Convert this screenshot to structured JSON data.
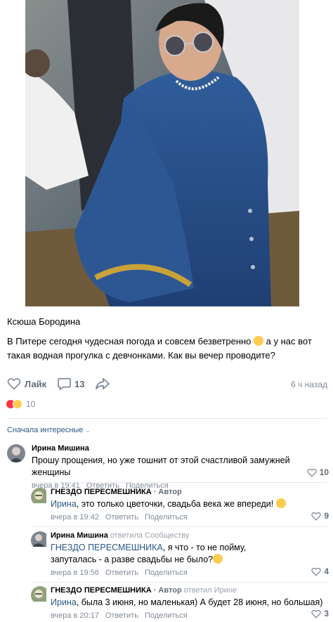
{
  "post": {
    "author": "Ксюша Бородина",
    "text_part1": "В Питере сегодня чудесная погода и совсем безветренно ",
    "text_part2": " а у нас вот такая водная прогулка с девчонками. Как вы вечер проводите?"
  },
  "actions": {
    "like_label": "Лайк",
    "comments_count": "13",
    "time_ago": "6 ч назад"
  },
  "reactions": {
    "count": "10"
  },
  "comments_sort": {
    "label": "Сначала интересные"
  },
  "comments": [
    {
      "name": "Ирина Мишина",
      "text": "Прошу прощения, но уже тошнит от этой счастливой замужней женщины",
      "time": "вчера в 19:41",
      "reply_label": "Ответить",
      "share_label": "Поделиться",
      "likes": "10"
    },
    {
      "name": "ГНЕЗДО ПЕРЕСМЕШНИКА",
      "author_tag": "· Автор",
      "text_link": "Ирина",
      "text": ", это только цветочки, свадьба века же впереди! ",
      "time": "вчера в 19:42",
      "reply_label": "Ответить",
      "share_label": "Поделиться",
      "likes": "9"
    },
    {
      "name": "Ирина Мишина",
      "replied": "ответила Сообществу",
      "text_link": "ГНЕЗДО ПЕРЕСМЕШНИКА",
      "text": ", я что - то не пойму, запуталась - а разве свадьбы не было?",
      "time": "вчера в 19:56",
      "reply_label": "Ответить",
      "share_label": "Поделиться",
      "likes": "4"
    },
    {
      "name": "ГНЕЗДО ПЕРЕСМЕШНИКА",
      "author_tag": "· Автор",
      "replied": "ответил Ирине",
      "text_link": "Ирина",
      "text": ", была 3 июня, но маленькая) А будет 28 июня, но большая)",
      "time": "вчера в 20:17",
      "reply_label": "Ответить",
      "share_label": "Поделиться",
      "likes": "3"
    }
  ],
  "colors": {
    "link": "#2a5885",
    "meta": "#818c99",
    "heart": "#ff3347",
    "divider": "#e7e8ec"
  }
}
